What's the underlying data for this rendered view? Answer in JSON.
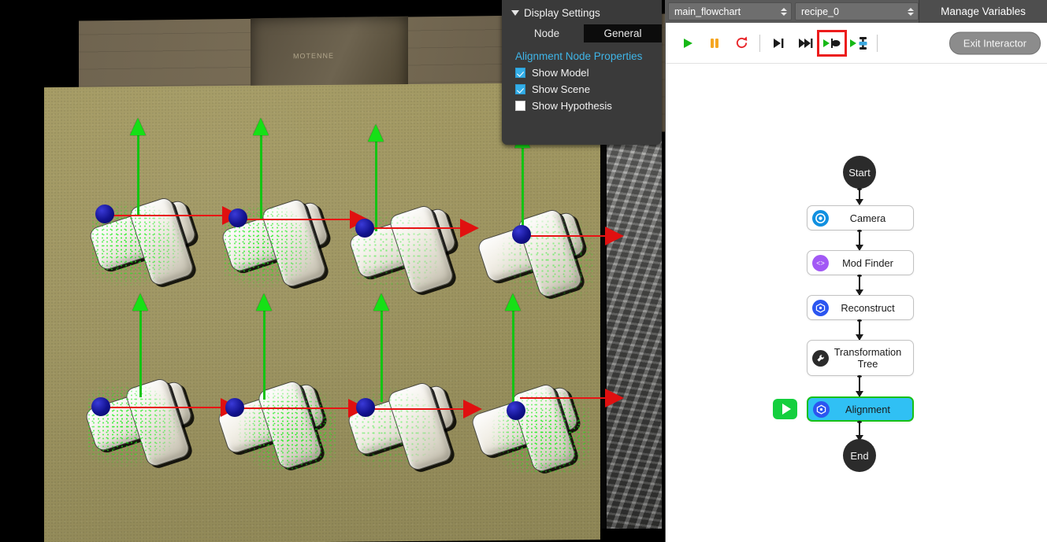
{
  "viewport": {
    "name": "3d-scene-viewport",
    "scene_description": "3D point-cloud scene of eight white PVC tee pipe fittings on cardboard with aligned model overlays",
    "overlay_colors": {
      "model_points": "#16e016",
      "z_axis_arrow": "#16e016",
      "x_axis_arrow": "#e01010",
      "origin_marker": "#12128f",
      "background": "#000000",
      "cardboard": "#9d9460"
    },
    "crate_label": "MOTENNE",
    "pose_count": 8
  },
  "display_settings": {
    "title": "Display Settings",
    "collapse_icon": "chevron-down-icon",
    "tabs": [
      {
        "label": "Node",
        "selected": false
      },
      {
        "label": "General",
        "selected": true
      }
    ],
    "properties_heading": "Alignment Node Properties",
    "heading_color": "#3fb5e8",
    "checkboxes": [
      {
        "label": "Show Model",
        "checked": true
      },
      {
        "label": "Show Scene",
        "checked": true
      },
      {
        "label": "Show Hypothesis",
        "checked": false
      }
    ]
  },
  "selector_bar": {
    "flowchart_select": {
      "value": "main_flowchart"
    },
    "recipe_select": {
      "value": "recipe_0"
    },
    "manage_variables_label": "Manage Variables"
  },
  "run_toolbar": {
    "buttons": [
      {
        "name": "run-button",
        "icon": "play-icon",
        "color": "#16b816",
        "highlighted": false
      },
      {
        "name": "pause-button",
        "icon": "pause-icon",
        "color": "#f5a623",
        "highlighted": false
      },
      {
        "name": "reset-button",
        "icon": "reload-icon",
        "color": "#e8262a",
        "highlighted": false
      },
      {
        "name": "step-button",
        "icon": "step-forward-icon",
        "color": "#1a1a1a",
        "highlighted": false
      },
      {
        "name": "step-over-button",
        "icon": "fast-forward-icon",
        "color": "#1a1a1a",
        "highlighted": false
      },
      {
        "name": "run-to-node-button",
        "icon": "play-to-node-icon",
        "color": "#1a1a1a",
        "highlighted": true
      },
      {
        "name": "run-from-node-button",
        "icon": "play-from-node-icon",
        "color": "#1a1a1a",
        "highlighted": false
      }
    ],
    "highlight_color": "#ec1c1c",
    "exit_interactor_label": "Exit Interactor"
  },
  "flowchart": {
    "start_label": "Start",
    "end_label": "End",
    "nodes": [
      {
        "label": "Camera",
        "icon": "camera-node-icon",
        "icon_color": "#1190e0",
        "selected": false
      },
      {
        "label": "Mod Finder",
        "icon": "mod-finder-node-icon",
        "icon_color": "#a259f5",
        "selected": false
      },
      {
        "label": "Reconstruct",
        "icon": "reconstruct-node-icon",
        "icon_color": "#2b55f0",
        "selected": false
      },
      {
        "label": "Transformation Tree",
        "icon": "transformation-tree-node-icon",
        "icon_color": "#2b2b2b",
        "selected": false
      },
      {
        "label": "Alignment",
        "icon": "alignment-node-icon",
        "icon_color": "#2b55f0",
        "selected": true
      }
    ],
    "selected_node_fill": "#30c0f4",
    "selected_node_border": "#17c217",
    "run_badge": {
      "icon": "play-icon",
      "color": "#14cf3e"
    }
  }
}
